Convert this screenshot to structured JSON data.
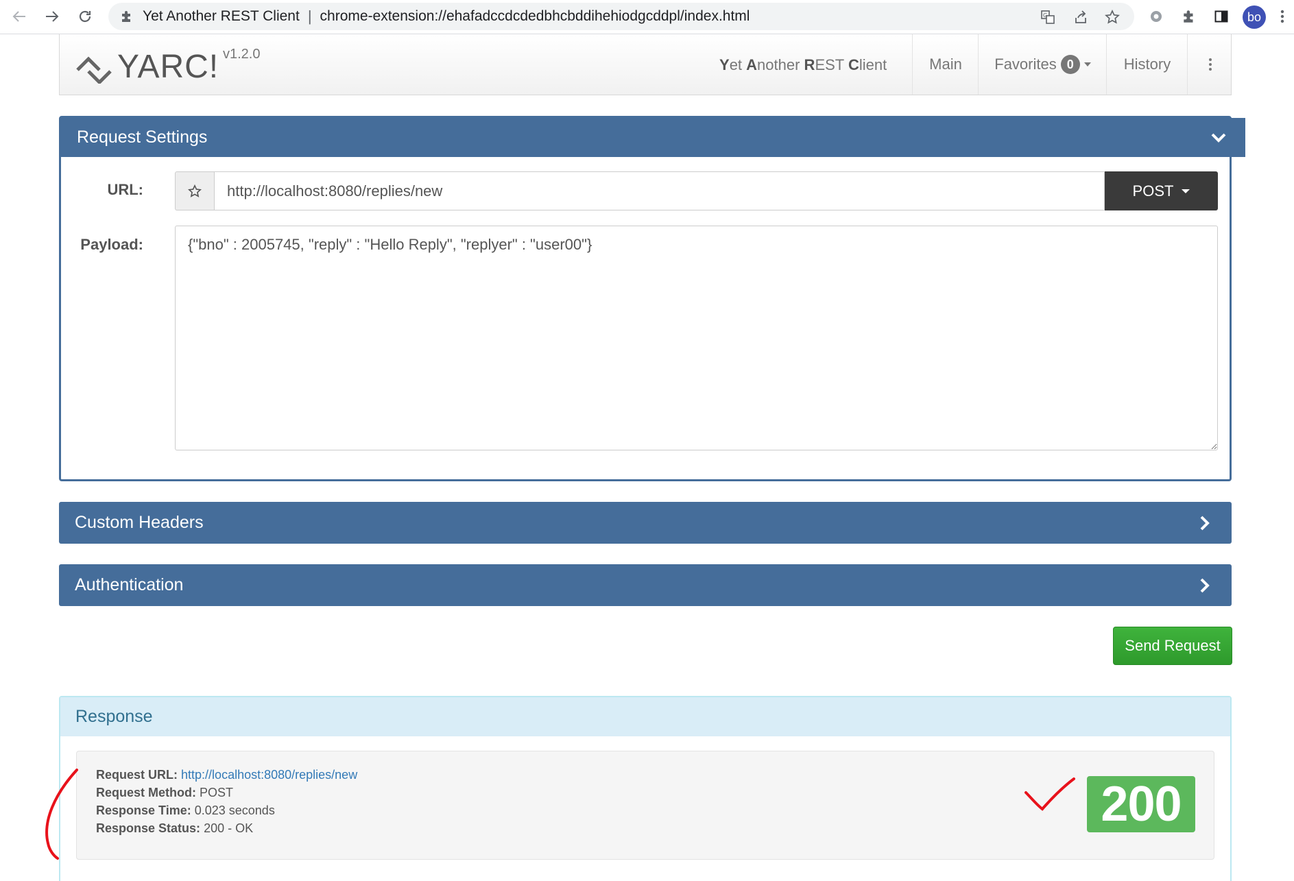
{
  "browser": {
    "site_name": "Yet Another REST Client",
    "separator": "|",
    "url": "chrome-extension://ehafadccdcdedbhcbddihehiodgcddpl/index.html",
    "avatar_initials": "bo"
  },
  "app": {
    "logo_text": "YARC!",
    "version": "v1.2.0",
    "tagline_parts": [
      "Y",
      "et ",
      "A",
      "nother ",
      "R",
      "EST ",
      "C",
      "lient"
    ],
    "nav": {
      "main": "Main",
      "favorites": "Favorites",
      "favorites_count": "0",
      "history": "History"
    }
  },
  "request_settings": {
    "title": "Request Settings",
    "url_label": "URL:",
    "url_value": "http://localhost:8080/replies/new",
    "method": "POST",
    "payload_label": "Payload:",
    "payload_value": "{\"bno\" : 2005745, \"reply\" : \"Hello Reply\", \"replyer\" : \"user00\"}"
  },
  "custom_headers": {
    "title": "Custom Headers"
  },
  "authentication": {
    "title": "Authentication"
  },
  "send_button": "Send Request",
  "response": {
    "title": "Response",
    "request_url_label": "Request URL:",
    "request_url_value": "http://localhost:8080/replies/new",
    "request_method_label": "Request Method:",
    "request_method_value": "POST",
    "response_time_label": "Response Time:",
    "response_time_value": "0.023 seconds",
    "response_status_label": "Response Status:",
    "response_status_value": "200 - OK",
    "status_code": "200"
  },
  "colors": {
    "panel_primary": "#456d9a",
    "send_button": "#2e9a2c",
    "status_success": "#5cb85c",
    "response_header_bg": "#d9edf7",
    "annotation": "#e8121b"
  }
}
